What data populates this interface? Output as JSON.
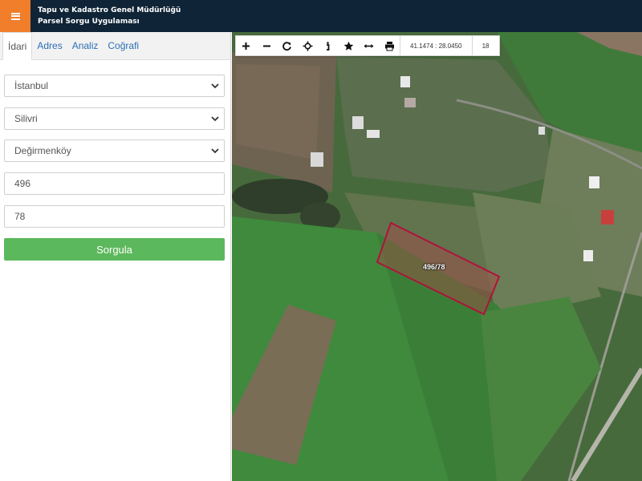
{
  "header": {
    "org_name": "Tapu ve Kadastro Genel Müdürlüğü",
    "app_name": "Parsel Sorgu Uygulaması"
  },
  "tabs": [
    {
      "label": "İdari",
      "active": true
    },
    {
      "label": "Adres",
      "active": false
    },
    {
      "label": "Analiz",
      "active": false
    },
    {
      "label": "Coğrafi",
      "active": false
    }
  ],
  "form": {
    "province": "İstanbul",
    "district": "Silivri",
    "neighborhood": "Değirmenköy",
    "block_no": "496",
    "parcel_no": "78",
    "query_button": "Sorgula"
  },
  "map": {
    "coordinates": "41.1474 : 28.0450",
    "zoom_level": "18",
    "parcel_label": "496/78",
    "parcel_outline_color": "#b0123a"
  },
  "toolbar_icons": [
    "zoom-in-icon",
    "zoom-out-icon",
    "refresh-icon",
    "locate-icon",
    "info-icon",
    "bookmark-star-icon",
    "measure-distance-icon",
    "print-icon"
  ],
  "colors": {
    "header_bg": "#0f2436",
    "menu_accent": "#f07e2b",
    "button_green": "#5cb85c",
    "link_blue": "#2a6fb5"
  }
}
